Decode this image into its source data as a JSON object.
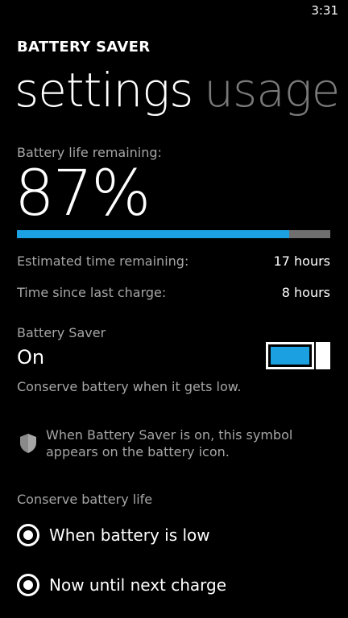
{
  "status_bar": {
    "time": "3:31"
  },
  "app": {
    "title": "BATTERY SAVER"
  },
  "pivot": {
    "tabs": [
      {
        "label": "settings",
        "active": true
      },
      {
        "label": "usage",
        "active": false
      }
    ]
  },
  "battery": {
    "remaining_label": "Battery life remaining:",
    "percent_text": "87%",
    "level": 0.87,
    "bar_fill_color": "#1ba1e2",
    "bar_track_color": "#6f6f6f"
  },
  "estimates": [
    {
      "label": "Estimated time remaining:",
      "value": "17 hours"
    },
    {
      "label": "Time since last charge:",
      "value": "8 hours"
    }
  ],
  "saver": {
    "label": "Battery Saver",
    "state_text": "On",
    "toggle_on": true,
    "description": "Conserve battery when it gets low.",
    "note": "When Battery Saver is on, this symbol appears on the battery icon.",
    "note_icon": "shield-icon"
  },
  "conserve": {
    "label": "Conserve battery life",
    "options": [
      {
        "label": "When battery is low"
      },
      {
        "label": "Now until next charge"
      }
    ]
  }
}
